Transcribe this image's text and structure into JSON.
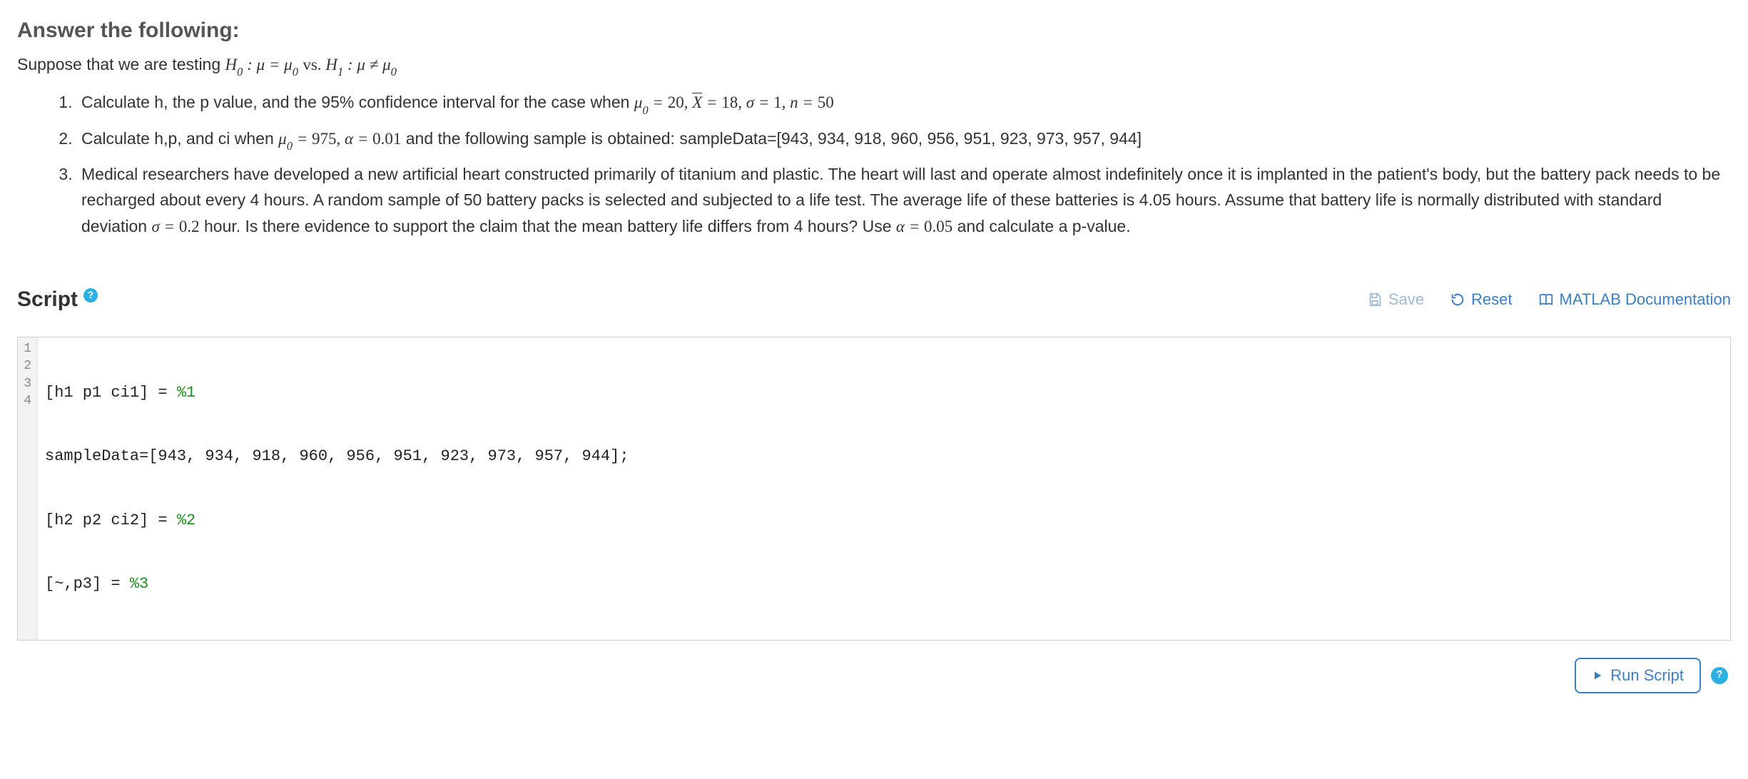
{
  "heading": "Answer the following:",
  "intro_prefix": "Suppose that we are testing ",
  "questions": {
    "q1_prefix": "Calculate h, the p value, and the 95% confidence interval for the case when ",
    "q2_prefix": "Calculate h,p, and ci when ",
    "q2_mid": " and the following sample is obtained: sampleData=[943, 934, 918, 960, 956, 951, 923, 973, 957, 944]",
    "q3_part1": "Medical researchers have developed a new artificial heart constructed primarily of titanium and plastic. The heart will last and operate almost indefinitely once it is implanted in the patient's body, but the battery pack needs to be recharged about every 4 hours. A random sample of 50 battery packs is selected and subjected to a life test. The average life of these batteries is 4.05 hours. Assume that battery life is normally distributed with standard deviation ",
    "q3_part2": " hour. Is there evidence to support the claim that the mean battery life differs from 4 hours? Use ",
    "q3_part3": " and calculate a p-value."
  },
  "script_section": {
    "title": "Script",
    "help_glyph": "?"
  },
  "toolbar": {
    "save": "Save",
    "reset": "Reset",
    "docs": "MATLAB Documentation"
  },
  "code": {
    "lines": [
      {
        "n": "1",
        "text": "[h1 p1 ci1] = ",
        "comment": "%1"
      },
      {
        "n": "2",
        "text": "sampleData=[943, 934, 918, 960, 956, 951, 923, 973, 957, 944];",
        "comment": ""
      },
      {
        "n": "3",
        "text": "[h2 p2 ci2] = ",
        "comment": "%2"
      },
      {
        "n": "4",
        "text": "[~,p3] = ",
        "comment": "%3"
      }
    ]
  },
  "footer": {
    "run": "Run Script",
    "help_glyph": "?"
  }
}
